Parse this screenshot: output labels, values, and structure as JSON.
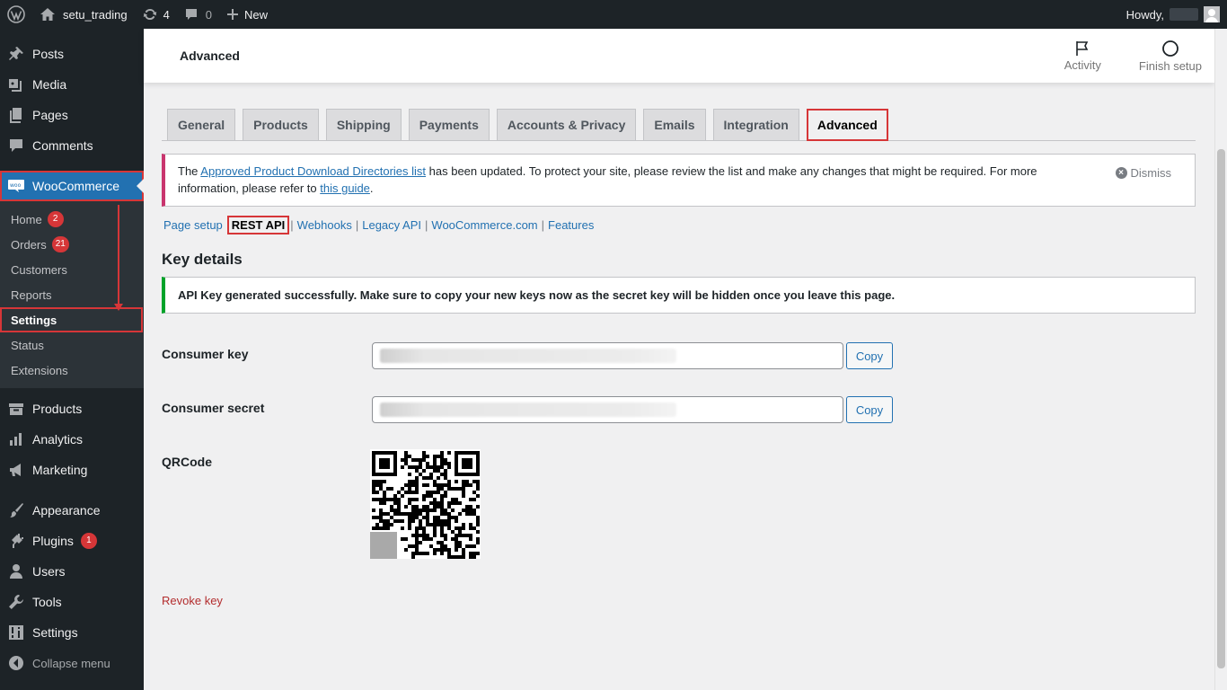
{
  "admin_bar": {
    "site_name": "setu_trading",
    "updates_count": "4",
    "comments_count": "0",
    "new_label": "New",
    "howdy_label": "Howdy,"
  },
  "sidebar": {
    "items_top": [
      {
        "label": "Posts",
        "icon": "pushpin-icon"
      },
      {
        "label": "Media",
        "icon": "media-icon"
      },
      {
        "label": "Pages",
        "icon": "pages-icon"
      },
      {
        "label": "Comments",
        "icon": "comment-icon"
      }
    ],
    "woocommerce": {
      "label": "WooCommerce",
      "icon": "woocommerce-icon"
    },
    "submenu": [
      {
        "label": "Home",
        "badge": "2"
      },
      {
        "label": "Orders",
        "badge": "21"
      },
      {
        "label": "Customers"
      },
      {
        "label": "Reports"
      },
      {
        "label": "Settings",
        "current": true
      },
      {
        "label": "Status"
      },
      {
        "label": "Extensions"
      }
    ],
    "items_mid": [
      {
        "label": "Products",
        "icon": "archive-icon"
      },
      {
        "label": "Analytics",
        "icon": "bar-chart-icon"
      },
      {
        "label": "Marketing",
        "icon": "megaphone-icon"
      }
    ],
    "items_bottom": [
      {
        "label": "Appearance",
        "icon": "paintbrush-icon"
      },
      {
        "label": "Plugins",
        "icon": "plugin-icon",
        "badge": "1"
      },
      {
        "label": "Users",
        "icon": "user-icon"
      },
      {
        "label": "Tools",
        "icon": "wrench-icon"
      },
      {
        "label": "Settings",
        "icon": "sliders-icon"
      }
    ],
    "collapse_label": "Collapse menu"
  },
  "header": {
    "title": "Advanced",
    "activity_label": "Activity",
    "finish_setup_label": "Finish setup"
  },
  "tabs": [
    {
      "label": "General"
    },
    {
      "label": "Products"
    },
    {
      "label": "Shipping"
    },
    {
      "label": "Payments"
    },
    {
      "label": "Accounts & Privacy"
    },
    {
      "label": "Emails"
    },
    {
      "label": "Integration"
    },
    {
      "label": "Advanced",
      "active": true
    }
  ],
  "notice": {
    "text_before": "The ",
    "link1": "Approved Product Download Directories list",
    "text_middle": " has been updated. To protect your site, please review the list and make any changes that might be required. For more information, please refer to ",
    "link2": "this guide",
    "text_after": ".",
    "dismiss_label": "Dismiss"
  },
  "subnav": {
    "page_setup": "Page setup",
    "rest_api": "REST API",
    "webhooks": "Webhooks",
    "legacy_api": "Legacy API",
    "woocommerce_com": "WooCommerce.com",
    "features": "Features"
  },
  "key_details": {
    "title": "Key details",
    "success_message": "API Key generated successfully. Make sure to copy your new keys now as the secret key will be hidden once you leave this page.",
    "consumer_key_label": "Consumer key",
    "consumer_secret_label": "Consumer secret",
    "copy_label": "Copy",
    "qrcode_label": "QRCode",
    "revoke_label": "Revoke key"
  }
}
